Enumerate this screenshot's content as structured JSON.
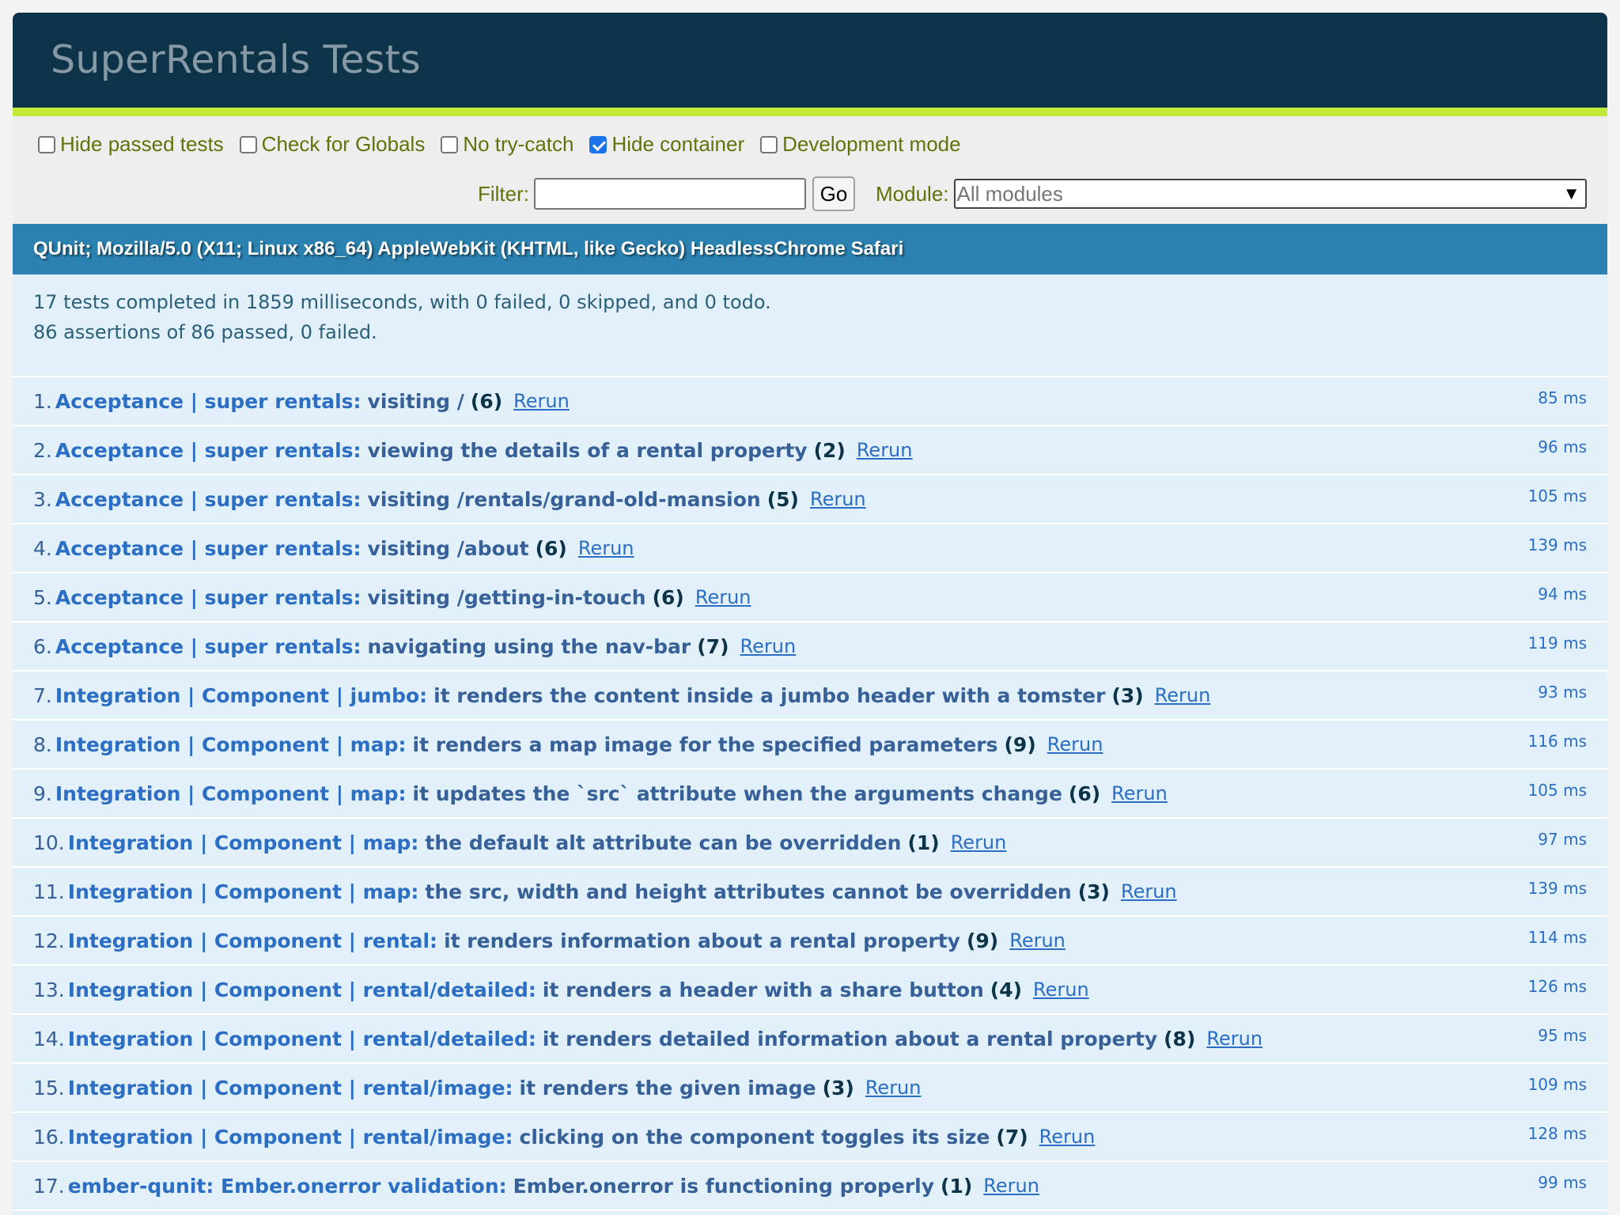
{
  "header": {
    "title": "SuperRentals Tests"
  },
  "toolbar": {
    "options": [
      {
        "label": "Hide passed tests",
        "checked": false
      },
      {
        "label": "Check for Globals",
        "checked": false
      },
      {
        "label": "No try-catch",
        "checked": false
      },
      {
        "label": "Hide container",
        "checked": true
      },
      {
        "label": "Development mode",
        "checked": false
      }
    ],
    "filter_label": "Filter:",
    "filter_value": "",
    "go_label": "Go",
    "module_label": "Module:",
    "module_selected": "All modules"
  },
  "user_agent": "QUnit; Mozilla/5.0 (X11; Linux x86_64) AppleWebKit (KHTML, like Gecko) HeadlessChrome Safari",
  "results": {
    "line1": "17 tests completed in 1859 milliseconds, with 0 failed, 0 skipped, and 0 todo.",
    "line2": "86 assertions of 86 passed, 0 failed."
  },
  "rerun_label": "Rerun",
  "tests": [
    {
      "num": "1.",
      "module": "Acceptance | super rentals:",
      "name": "visiting /",
      "count": "(6)",
      "duration": "85 ms"
    },
    {
      "num": "2.",
      "module": "Acceptance | super rentals:",
      "name": "viewing the details of a rental property",
      "count": "(2)",
      "duration": "96 ms"
    },
    {
      "num": "3.",
      "module": "Acceptance | super rentals:",
      "name": "visiting /rentals/grand-old-mansion",
      "count": "(5)",
      "duration": "105 ms"
    },
    {
      "num": "4.",
      "module": "Acceptance | super rentals:",
      "name": "visiting /about",
      "count": "(6)",
      "duration": "139 ms"
    },
    {
      "num": "5.",
      "module": "Acceptance | super rentals:",
      "name": "visiting /getting-in-touch",
      "count": "(6)",
      "duration": "94 ms"
    },
    {
      "num": "6.",
      "module": "Acceptance | super rentals:",
      "name": "navigating using the nav-bar",
      "count": "(7)",
      "duration": "119 ms"
    },
    {
      "num": "7.",
      "module": "Integration | Component | jumbo:",
      "name": "it renders the content inside a jumbo header with a tomster",
      "count": "(3)",
      "duration": "93 ms"
    },
    {
      "num": "8.",
      "module": "Integration | Component | map:",
      "name": "it renders a map image for the specified parameters",
      "count": "(9)",
      "duration": "116 ms"
    },
    {
      "num": "9.",
      "module": "Integration | Component | map:",
      "name": "it updates the `src` attribute when the arguments change",
      "count": "(6)",
      "duration": "105 ms"
    },
    {
      "num": "10.",
      "module": "Integration | Component | map:",
      "name": "the default alt attribute can be overridden",
      "count": "(1)",
      "duration": "97 ms"
    },
    {
      "num": "11.",
      "module": "Integration | Component | map:",
      "name": "the src, width and height attributes cannot be overridden",
      "count": "(3)",
      "duration": "139 ms"
    },
    {
      "num": "12.",
      "module": "Integration | Component | rental:",
      "name": "it renders information about a rental property",
      "count": "(9)",
      "duration": "114 ms"
    },
    {
      "num": "13.",
      "module": "Integration | Component | rental/detailed:",
      "name": "it renders a header with a share button",
      "count": "(4)",
      "duration": "126 ms"
    },
    {
      "num": "14.",
      "module": "Integration | Component | rental/detailed:",
      "name": "it renders detailed information about a rental property",
      "count": "(8)",
      "duration": "95 ms"
    },
    {
      "num": "15.",
      "module": "Integration | Component | rental/image:",
      "name": "it renders the given image",
      "count": "(3)",
      "duration": "109 ms"
    },
    {
      "num": "16.",
      "module": "Integration | Component | rental/image:",
      "name": "clicking on the component toggles its size",
      "count": "(7)",
      "duration": "128 ms"
    },
    {
      "num": "17.",
      "module": "ember-qunit: Ember.onerror validation:",
      "name": "Ember.onerror is functioning properly",
      "count": "(1)",
      "duration": "99 ms"
    }
  ]
}
